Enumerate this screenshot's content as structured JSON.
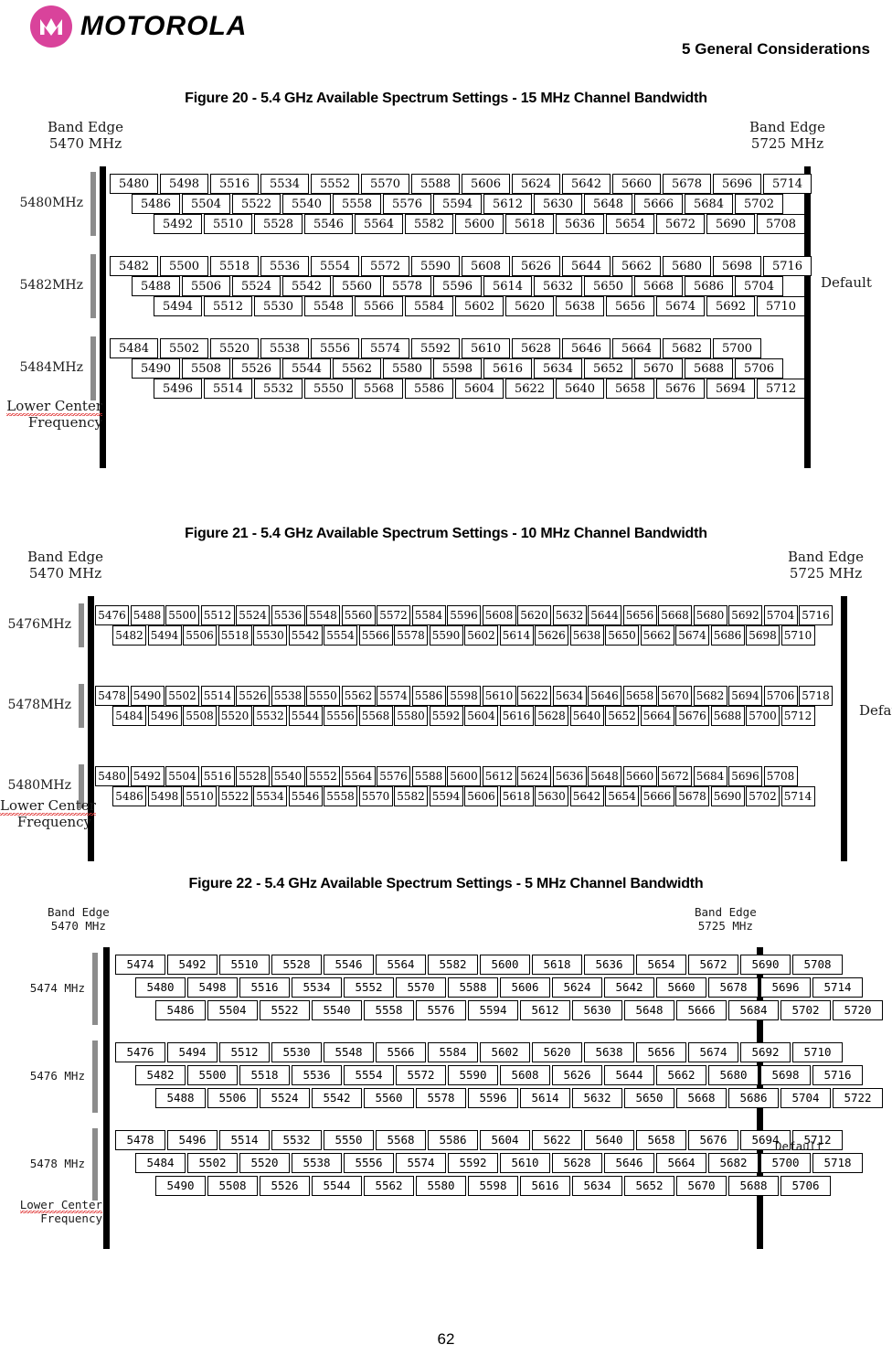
{
  "header": {
    "brand": "MOTOROLA",
    "chapter": "5 General Considerations",
    "logo_icon": "motorola-m-logo"
  },
  "page_number": "62",
  "common": {
    "band_edge_left": "Band Edge\n5470 MHz",
    "band_edge_left_line1": "Band Edge",
    "band_edge_left_line2": "5470 MHz",
    "band_edge_right_line1": "Band Edge",
    "band_edge_right_line2": "5725 MHz",
    "default_label": "Default",
    "lcf_line1": "Lower Center",
    "lcf_line2": "Frequency"
  },
  "figures": [
    {
      "id": "figure-20",
      "caption": "Figure 20 - 5.4 GHz Available Spectrum Settings - 15 MHz Channel Bandwidth",
      "channel_bandwidth_mhz": 15,
      "groups": [
        {
          "label": "5480MHz",
          "rows": [
            [
              5480,
              5498,
              5516,
              5534,
              5552,
              5570,
              5588,
              5606,
              5624,
              5642,
              5660,
              5678,
              5696,
              5714
            ],
            [
              5486,
              5504,
              5522,
              5540,
              5558,
              5576,
              5594,
              5612,
              5630,
              5648,
              5666,
              5684,
              5702
            ],
            [
              5492,
              5510,
              5528,
              5546,
              5564,
              5582,
              5600,
              5618,
              5636,
              5654,
              5672,
              5690,
              5708
            ]
          ]
        },
        {
          "label": "5482MHz",
          "rows": [
            [
              5482,
              5500,
              5518,
              5536,
              5554,
              5572,
              5590,
              5608,
              5626,
              5644,
              5662,
              5680,
              5698,
              5716
            ],
            [
              5488,
              5506,
              5524,
              5542,
              5560,
              5578,
              5596,
              5614,
              5632,
              5650,
              5668,
              5686,
              5704
            ],
            [
              5494,
              5512,
              5530,
              5548,
              5566,
              5584,
              5602,
              5620,
              5638,
              5656,
              5674,
              5692,
              5710
            ]
          ]
        },
        {
          "label": "5484MHz",
          "rows": [
            [
              5484,
              5502,
              5520,
              5538,
              5556,
              5574,
              5592,
              5610,
              5628,
              5646,
              5664,
              5682,
              5700
            ],
            [
              5490,
              5508,
              5526,
              5544,
              5562,
              5580,
              5598,
              5616,
              5634,
              5652,
              5670,
              5688,
              5706
            ],
            [
              5496,
              5514,
              5532,
              5550,
              5568,
              5586,
              5604,
              5622,
              5640,
              5658,
              5676,
              5694,
              5712
            ]
          ]
        }
      ]
    },
    {
      "id": "figure-21",
      "caption": "Figure 21 - 5.4 GHz Available Spectrum Settings - 10 MHz Channel Bandwidth",
      "channel_bandwidth_mhz": 10,
      "groups": [
        {
          "label": "5476MHz",
          "rows": [
            [
              5476,
              5488,
              5500,
              5512,
              5524,
              5536,
              5548,
              5560,
              5572,
              5584,
              5596,
              5608,
              5620,
              5632,
              5644,
              5656,
              5668,
              5680,
              5692,
              5704,
              5716
            ],
            [
              5482,
              5494,
              5506,
              5518,
              5530,
              5542,
              5554,
              5566,
              5578,
              5590,
              5602,
              5614,
              5626,
              5638,
              5650,
              5662,
              5674,
              5686,
              5698,
              5710
            ]
          ]
        },
        {
          "label": "5478MHz",
          "rows": [
            [
              5478,
              5490,
              5502,
              5514,
              5526,
              5538,
              5550,
              5562,
              5574,
              5586,
              5598,
              5610,
              5622,
              5634,
              5646,
              5658,
              5670,
              5682,
              5694,
              5706,
              5718
            ],
            [
              5484,
              5496,
              5508,
              5520,
              5532,
              5544,
              5556,
              5568,
              5580,
              5592,
              5604,
              5616,
              5628,
              5640,
              5652,
              5664,
              5676,
              5688,
              5700,
              5712
            ]
          ]
        },
        {
          "label": "5480MHz",
          "rows": [
            [
              5480,
              5492,
              5504,
              5516,
              5528,
              5540,
              5552,
              5564,
              5576,
              5588,
              5600,
              5612,
              5624,
              5636,
              5648,
              5660,
              5672,
              5684,
              5696,
              5708
            ],
            [
              5486,
              5498,
              5510,
              5522,
              5534,
              5546,
              5558,
              5570,
              5582,
              5594,
              5606,
              5618,
              5630,
              5642,
              5654,
              5666,
              5678,
              5690,
              5702,
              5714
            ]
          ]
        }
      ]
    },
    {
      "id": "figure-22",
      "caption": "Figure 22 - 5.4 GHz Available Spectrum Settings - 5 MHz Channel Bandwidth",
      "channel_bandwidth_mhz": 5,
      "groups": [
        {
          "label": "5474 MHz",
          "rows": [
            [
              5474,
              5492,
              5510,
              5528,
              5546,
              5564,
              5582,
              5600,
              5618,
              5636,
              5654,
              5672,
              5690,
              5708
            ],
            [
              5480,
              5498,
              5516,
              5534,
              5552,
              5570,
              5588,
              5606,
              5624,
              5642,
              5660,
              5678,
              5696,
              5714
            ],
            [
              5486,
              5504,
              5522,
              5540,
              5558,
              5576,
              5594,
              5612,
              5630,
              5648,
              5666,
              5684,
              5702,
              5720
            ]
          ]
        },
        {
          "label": "5476 MHz",
          "rows": [
            [
              5476,
              5494,
              5512,
              5530,
              5548,
              5566,
              5584,
              5602,
              5620,
              5638,
              5656,
              5674,
              5692,
              5710
            ],
            [
              5482,
              5500,
              5518,
              5536,
              5554,
              5572,
              5590,
              5608,
              5626,
              5644,
              5662,
              5680,
              5698,
              5716
            ],
            [
              5488,
              5506,
              5524,
              5542,
              5560,
              5578,
              5596,
              5614,
              5632,
              5650,
              5668,
              5686,
              5704,
              5722
            ]
          ]
        },
        {
          "label": "5478 MHz",
          "rows": [
            [
              5478,
              5496,
              5514,
              5532,
              5550,
              5568,
              5586,
              5604,
              5622,
              5640,
              5658,
              5676,
              5694,
              5712
            ],
            [
              5484,
              5502,
              5520,
              5538,
              5556,
              5574,
              5592,
              5610,
              5628,
              5646,
              5664,
              5682,
              5700,
              5718
            ],
            [
              5490,
              5508,
              5526,
              5544,
              5562,
              5580,
              5598,
              5616,
              5634,
              5652,
              5670,
              5688,
              5706
            ]
          ]
        }
      ]
    }
  ]
}
